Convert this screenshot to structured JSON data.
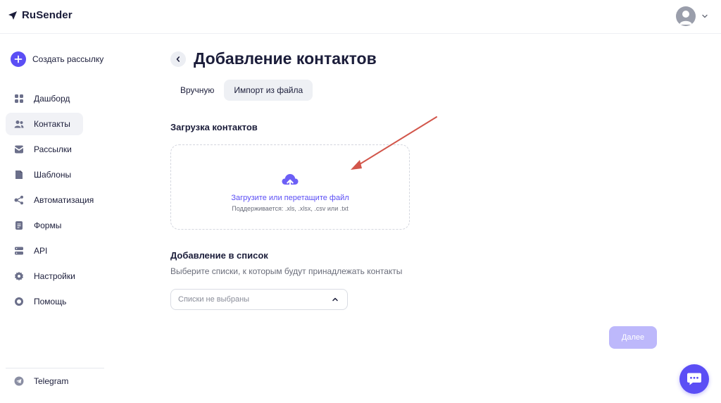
{
  "brand": {
    "name": "RuSender"
  },
  "sidebar": {
    "create_label": "Создать рассылку",
    "items": [
      {
        "label": "Дашборд",
        "icon": "dashboard-icon",
        "active": false
      },
      {
        "label": "Контакты",
        "icon": "contacts-icon",
        "active": true
      },
      {
        "label": "Рассылки",
        "icon": "mailings-icon",
        "active": false
      },
      {
        "label": "Шаблоны",
        "icon": "templates-icon",
        "active": false
      },
      {
        "label": "Автоматизация",
        "icon": "automation-icon",
        "active": false
      },
      {
        "label": "Формы",
        "icon": "forms-icon",
        "active": false
      },
      {
        "label": "API",
        "icon": "api-icon",
        "active": false
      },
      {
        "label": "Настройки",
        "icon": "settings-icon",
        "active": false
      },
      {
        "label": "Помощь",
        "icon": "help-icon",
        "active": false
      }
    ],
    "telegram_label": "Telegram"
  },
  "main": {
    "title": "Добавление контактов",
    "tabs": [
      {
        "label": "Вручную",
        "active": false
      },
      {
        "label": "Импорт из файла",
        "active": true
      }
    ],
    "upload": {
      "title": "Загрузка контактов",
      "main_text": "Загрузите или перетащите файл",
      "formats_text": "Поддерживается: .xls, .xlsx, .csv или .txt"
    },
    "list_section": {
      "title": "Добавление в список",
      "description": "Выберите списки, к которым будут принадлежать контакты",
      "select_value": "Списки не выбраны"
    },
    "next_label": "Далее"
  },
  "colors": {
    "accent": "#5b4ef5",
    "arrow": "#d2564b",
    "disabled_button": "#bdb8fb"
  }
}
